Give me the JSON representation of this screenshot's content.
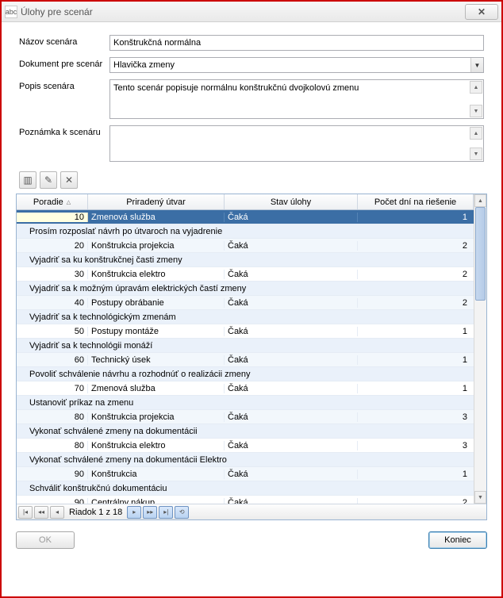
{
  "window": {
    "title": "Úlohy pre scenár"
  },
  "form": {
    "nazov_label": "Názov scenára",
    "nazov_value": "Konštrukčná normálna",
    "dokument_label": "Dokument pre scenár",
    "dokument_value": "Hlavička zmeny",
    "popis_label": "Popis scenára",
    "popis_value": "Tento scenár popisuje normálnu konštrukčnú dvojkolovú zmenu",
    "poznamka_label": "Poznámka k scenáru",
    "poznamka_value": ""
  },
  "columns": {
    "poradie": "Poradie",
    "utvar": "Priradený útvar",
    "stav": "Stav úlohy",
    "dni": "Počet dní na riešenie"
  },
  "rows": [
    {
      "type": "data",
      "selected": true,
      "poradie": "10",
      "utvar": "Zmenová služba",
      "stav": "Čaká",
      "dni": "1"
    },
    {
      "type": "group",
      "text": "Prosím rozposlať návrh po útvaroch na vyjadrenie"
    },
    {
      "type": "data",
      "poradie": "20",
      "utvar": "Konštrukcia projekcia",
      "stav": "Čaká",
      "dni": "2"
    },
    {
      "type": "group",
      "text": "Vyjadriť sa  ku konštrukčnej časti zmeny"
    },
    {
      "type": "data",
      "poradie": "30",
      "utvar": "Konštrukcia elektro",
      "stav": "Čaká",
      "dni": "2"
    },
    {
      "type": "group",
      "text": "Vyjadriť sa k možným úpravám elektrických častí zmeny"
    },
    {
      "type": "data",
      "poradie": "40",
      "utvar": "Postupy obrábanie",
      "stav": "Čaká",
      "dni": "2"
    },
    {
      "type": "group",
      "text": "Vyjadriť sa k technológickým zmenám"
    },
    {
      "type": "data",
      "poradie": "50",
      "utvar": "Postupy montáže",
      "stav": "Čaká",
      "dni": "1"
    },
    {
      "type": "group",
      "text": "Vyjadriť sa k technológii monáží"
    },
    {
      "type": "data",
      "poradie": "60",
      "utvar": "Technický úsek",
      "stav": "Čaká",
      "dni": "1"
    },
    {
      "type": "group",
      "text": "Povoliť schválenie návrhu a rozhodnúť o realizácii zmeny"
    },
    {
      "type": "data",
      "poradie": "70",
      "utvar": "Zmenová služba",
      "stav": "Čaká",
      "dni": "1"
    },
    {
      "type": "group",
      "text": "Ustanoviť príkaz na zmenu"
    },
    {
      "type": "data",
      "poradie": "80",
      "utvar": "Konštrukcia projekcia",
      "stav": "Čaká",
      "dni": "3"
    },
    {
      "type": "group",
      "text": "Vykonať schválené zmeny na dokumentácii"
    },
    {
      "type": "data",
      "poradie": "80",
      "utvar": "Konštrukcia elektro",
      "stav": "Čaká",
      "dni": "3"
    },
    {
      "type": "group",
      "text": "Vykonať schválené zmeny na dokumentácii Elektro"
    },
    {
      "type": "data",
      "poradie": "90",
      "utvar": "Konštrukcia",
      "stav": "Čaká",
      "dni": "1"
    },
    {
      "type": "group",
      "text": "Schváliť konštrukčnú dokumentáciu"
    },
    {
      "type": "data",
      "poradie": "90",
      "utvar": "Centrálny nákup",
      "stav": "Čaká",
      "dni": "2"
    }
  ],
  "footer": {
    "row_label": "Riadok 1 z 18"
  },
  "buttons": {
    "ok": "OK",
    "koniec": "Koniec"
  }
}
